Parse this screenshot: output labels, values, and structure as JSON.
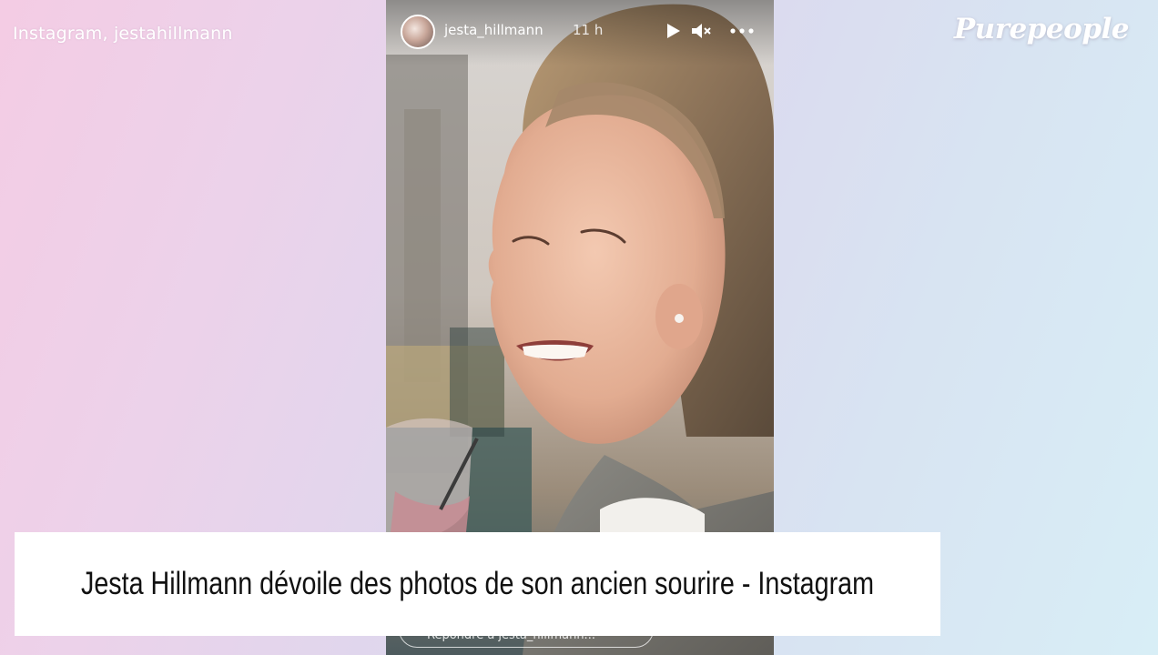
{
  "photo_credit": "Instagram, jestahillmann",
  "brand": "Purepeople",
  "story": {
    "username": "jesta_hillmann",
    "time": "11 h",
    "reply_placeholder": "Répondre à jesta_hillmann...",
    "controls": {
      "play_icon": "play-icon",
      "mute_icon": "speaker-muted-icon",
      "more_icon": "more-options-icon"
    }
  },
  "caption": "Jesta Hillmann dévoile des photos de son ancien sourire - Instagram",
  "colors": {
    "caption_bg": "#ffffff",
    "caption_text": "#111111",
    "background_left": "#f4cce4",
    "background_right": "#d8eef6"
  }
}
